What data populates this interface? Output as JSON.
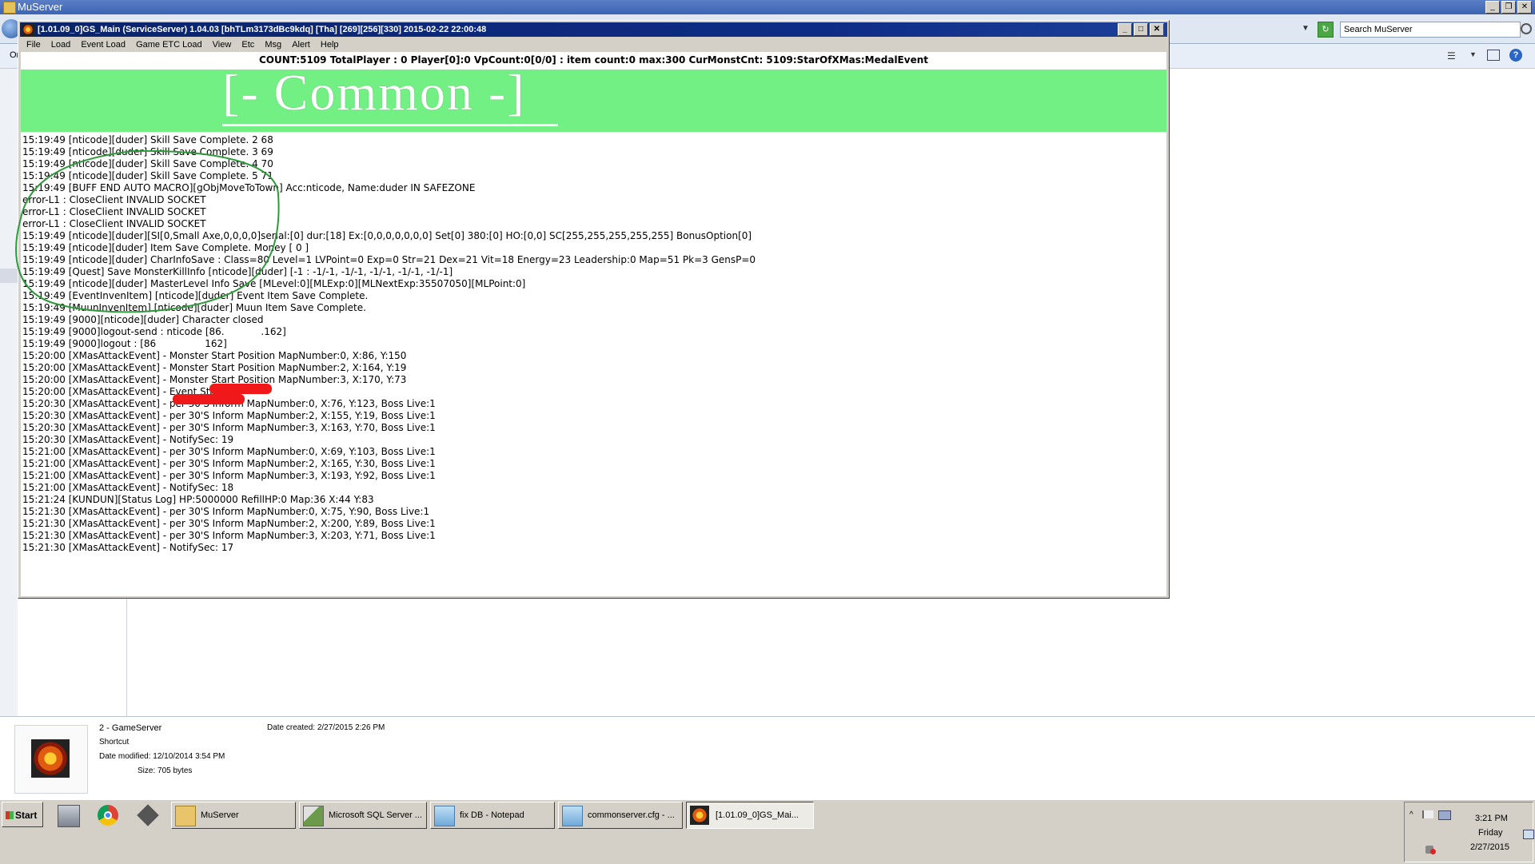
{
  "explorer": {
    "title": "MuServer",
    "search_placeholder": "Search MuServer",
    "toolbar_stub": "Or",
    "details": {
      "name": "2 - GameServer",
      "type": "Shortcut",
      "date_modified": "Date modified: 12/10/2014 3:54 PM",
      "size": "Size: 705 bytes",
      "date_created": "Date created: 2/27/2015 2:26 PM"
    }
  },
  "gameserver": {
    "title": "[1.01.09_0]GS_Main (ServiceServer) 1.04.03 [bhTLm3173dBc9kdq] [Tha] [269][256][330] 2015-02-22 22:00:48",
    "menu": [
      "File",
      "Load",
      "Event Load",
      "Game ETC Load",
      "View",
      "Etc",
      "Msg",
      "Alert",
      "Help"
    ],
    "status_line": "COUNT:5109  TotalPlayer : 0  Player[0]:0 VpCount:0[0/0] : item count:0 max:300 CurMonstCnt: 5109:StarOfXMas:MedalEvent",
    "banner": "[-  Common  -]",
    "log_lines": [
      "15:19:49 [nticode][duder] Skill Save Complete. 2 68",
      "15:19:49 [nticode][duder] Skill Save Complete. 3 69",
      "15:19:49 [nticode][duder] Skill Save Complete. 4 70",
      "15:19:49 [nticode][duder] Skill Save Complete. 5 71",
      "15:19:49 [BUFF  END  AUTO  MACRO][gObjMoveToTown] Acc:nticode, Name:duder IN SAFEZONE",
      "error-L1 : CloseClient INVALID  SOCKET",
      "error-L1 : CloseClient INVALID  SOCKET",
      "error-L1 : CloseClient INVALID  SOCKET",
      "15:19:49 [nticode][duder][SI[0,Small Axe,0,0,0,0]serial:[0] dur:[18] Ex:[0,0,0,0,0,0,0] Set[0] 380:[0] HO:[0,0] SC[255,255,255,255,255] BonusOption[0]",
      "15:19:49 [nticode][duder] Item Save Complete. Money [ 0 ]",
      "15:19:49 [nticode][duder] CharInfoSave : Class=80 Level=1 LVPoint=0 Exp=0 Str=21 Dex=21 Vit=18 Energy=23 Leadership:0 Map=51 Pk=3 GensP=0",
      "15:19:49 [Quest] Save MonsterKillInfo [nticode][duder] [-1 : -1/-1, -1/-1, -1/-1, -1/-1, -1/-1]",
      "15:19:49 [nticode][duder] MasterLevel Info Save [MLevel:0][MLExp:0][MLNextExp:35507050][MLPoint:0]",
      "15:19:49 [EventInvenItem] [nticode][duder] Event Item Save Complete.",
      "15:19:49 [MuunInvenItem] [nticode][duder] Muun Item Save Complete.",
      "15:19:49 [9000][nticode][duder] Character closed",
      "15:19:49 [9000]logout-send : nticode [86.      .162]",
      "15:19:49 [9000]logout :  [86        162]",
      "15:20:00 [XMasAttackEvent] - Monster Start Position MapNumber:0, X:86, Y:150",
      "15:20:00 [XMasAttackEvent] - Monster Start Position MapNumber:2, X:164, Y:19",
      "15:20:00 [XMasAttackEvent] - Monster Start Position MapNumber:3, X:170, Y:73",
      "15:20:00 [XMasAttackEvent] - Event Started",
      "15:20:30 [XMasAttackEvent] - per 30'S Inform MapNumber:0, X:76, Y:123, Boss Live:1",
      "15:20:30 [XMasAttackEvent] - per 30'S Inform MapNumber:2, X:155, Y:19, Boss Live:1",
      "15:20:30 [XMasAttackEvent] - per 30'S Inform MapNumber:3, X:163, Y:70, Boss Live:1",
      "15:20:30 [XMasAttackEvent] - NotifySec: 19",
      "15:21:00 [XMasAttackEvent] - per 30'S Inform MapNumber:0, X:69, Y:103, Boss Live:1",
      "15:21:00 [XMasAttackEvent] - per 30'S Inform MapNumber:2, X:165, Y:30, Boss Live:1",
      "15:21:00 [XMasAttackEvent] - per 30'S Inform MapNumber:3, X:193, Y:92, Boss Live:1",
      "15:21:00 [XMasAttackEvent] - NotifySec: 18",
      "15:21:24 [KUNDUN][Status Log] HP:5000000 RefillHP:0 Map:36 X:44 Y:83",
      "15:21:30 [XMasAttackEvent] - per 30'S Inform MapNumber:0, X:75, Y:90, Boss Live:1",
      "15:21:30 [XMasAttackEvent] - per 30'S Inform MapNumber:2, X:200, Y:89, Boss Live:1",
      "15:21:30 [XMasAttackEvent] - per 30'S Inform MapNumber:3, X:203, Y:71, Boss Live:1",
      "15:21:30 [XMasAttackEvent] - NotifySec: 17"
    ]
  },
  "taskbar": {
    "start": "Start",
    "buttons": [
      "MuServer",
      "Microsoft SQL Server ...",
      "fix DB - Notepad",
      "commonserver.cfg - ...",
      "[1.01.09_0]GS_Mai..."
    ],
    "time": "3:21 PM",
    "day": "Friday",
    "date": "2/27/2015"
  },
  "colors": {
    "banner_bg": "#72f084",
    "title_bar": "#0a246a",
    "scribble": "#2e9a3a",
    "redaction": "#f01818"
  }
}
